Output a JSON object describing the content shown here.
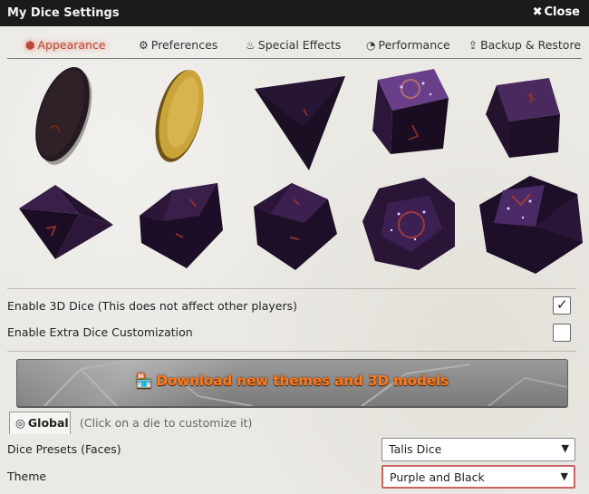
{
  "window": {
    "title": "My Dice Settings",
    "close_label": "Close"
  },
  "tabs": [
    {
      "label": "Appearance",
      "icon": "dice-icon",
      "active": true
    },
    {
      "label": "Preferences",
      "icon": "gears-icon",
      "active": false
    },
    {
      "label": "Special Effects",
      "icon": "flame-icon",
      "active": false
    },
    {
      "label": "Performance",
      "icon": "gauge-icon",
      "active": false
    },
    {
      "label": "Backup & Restore",
      "icon": "upload-icon",
      "active": false
    }
  ],
  "dice": [
    {
      "name": "coin-dark",
      "type": "coin"
    },
    {
      "name": "coin-gold",
      "type": "coin"
    },
    {
      "name": "d4",
      "type": "d4"
    },
    {
      "name": "d6-sparkle",
      "type": "d6"
    },
    {
      "name": "d6",
      "type": "d6"
    },
    {
      "name": "d8",
      "type": "d8"
    },
    {
      "name": "d10",
      "type": "d10"
    },
    {
      "name": "d10-percentile",
      "type": "d10"
    },
    {
      "name": "d12",
      "type": "d12"
    },
    {
      "name": "d20",
      "type": "d20"
    }
  ],
  "options": {
    "enable_3d_label": "Enable 3D Dice (This does not affect other players)",
    "enable_3d_checked": true,
    "extra_custom_label": "Enable Extra Dice Customization",
    "extra_custom_checked": false
  },
  "download_button": {
    "label": "Download new themes and 3D models",
    "icon": "store-icon"
  },
  "global": {
    "tab_label": "Global",
    "hint": "(Click on a die to customize it)"
  },
  "presets": {
    "label": "Dice Presets (Faces)",
    "value": "Talis Dice"
  },
  "theme": {
    "label": "Theme",
    "value": "Purple and Black"
  },
  "colors": {
    "accent_tab": "#b94b38",
    "download_text": "#ff7a1f",
    "die_purple": "#3b1a4a",
    "die_dark": "#1a0f22",
    "gold": "#c9a43a"
  }
}
